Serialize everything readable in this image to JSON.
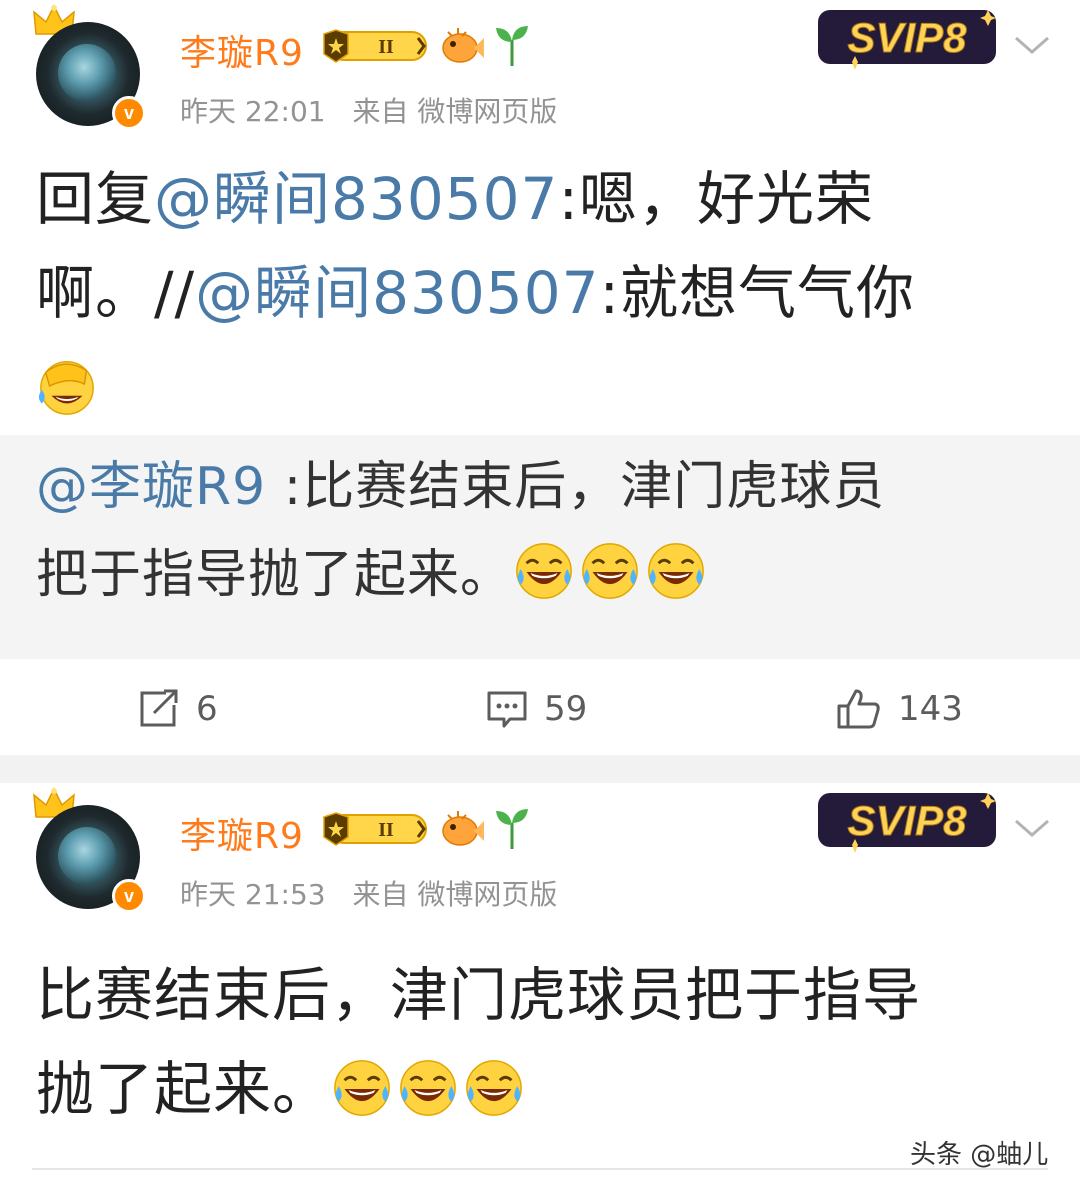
{
  "posts": [
    {
      "username": "李璇R9",
      "time": "昨天 22:01",
      "source": "来自 微博网页版",
      "text": {
        "l1_a": "回复",
        "l1_mention": "@瞬间830507",
        "l1_b": ":嗯，好光荣",
        "l2_a": "啊。//",
        "l2_mention": "@瞬间830507",
        "l2_b": ":就想气气你"
      },
      "repost": {
        "mention": "@李璇R9",
        "l1": " :比赛结束后，津门虎球员",
        "l2": "把于指导抛了起来。"
      },
      "actions": {
        "reposts": "6",
        "comments": "59",
        "likes": "143"
      }
    },
    {
      "username": "李璇R9",
      "time": "昨天 21:53",
      "source": "来自 微博网页版",
      "text": {
        "l1": "比赛结束后，津门虎球员把于指导",
        "l2": "抛了起来。"
      }
    }
  ],
  "badges": {
    "svip": "SVIP8",
    "level": "II",
    "verified": "v"
  },
  "icons": [
    "crown-icon",
    "level-badge-icon",
    "fish-icon",
    "sprout-icon",
    "chevron-down-icon",
    "facepalm-emoji",
    "laugh-cry-emoji",
    "repost-icon",
    "comment-icon",
    "like-icon"
  ],
  "colors": {
    "username": "#ff7a1a",
    "mention": "#4a7ba8",
    "meta": "#939393",
    "repost_bg": "#f4f4f4",
    "gap_bg": "#f2f2f2"
  },
  "watermark": "头条 @蚰儿"
}
